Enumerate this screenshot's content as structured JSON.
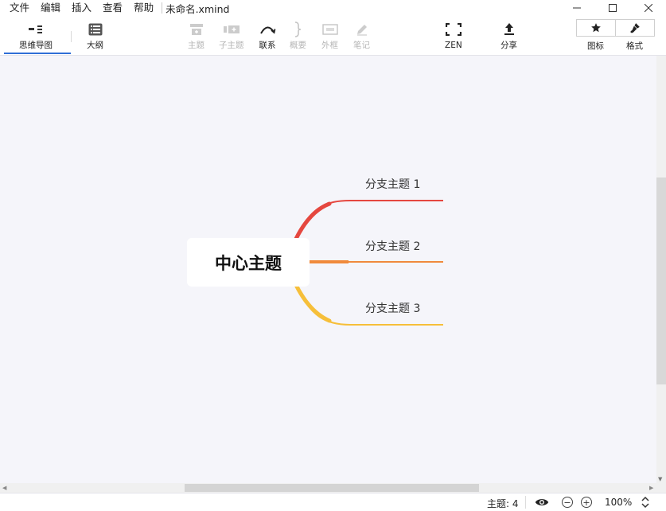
{
  "menubar": {
    "items": [
      "文件",
      "编辑",
      "插入",
      "查看",
      "帮助"
    ],
    "doc_title": "未命名.xmind"
  },
  "toolbar": {
    "mindmap_label": "思维导图",
    "outline_label": "大纲",
    "topic_label": "主题",
    "subtopic_label": "子主题",
    "relation_label": "联系",
    "summary_label": "概要",
    "boundary_label": "外框",
    "note_label": "笔记",
    "zen_label": "ZEN",
    "share_label": "分享",
    "icon_label": "图标",
    "format_label": "格式"
  },
  "mindmap": {
    "central_topic": "中心主题",
    "branches": [
      {
        "label": "分支主题 1",
        "color": "#e5473f"
      },
      {
        "label": "分支主题 2",
        "color": "#f08a3c"
      },
      {
        "label": "分支主题 3",
        "color": "#f6bf3a"
      }
    ]
  },
  "statusbar": {
    "topic_count": "主题: 4",
    "zoom": "100%"
  },
  "colors": {
    "accent": "#2f6fd6",
    "canvas_bg": "#f5f5fa"
  }
}
